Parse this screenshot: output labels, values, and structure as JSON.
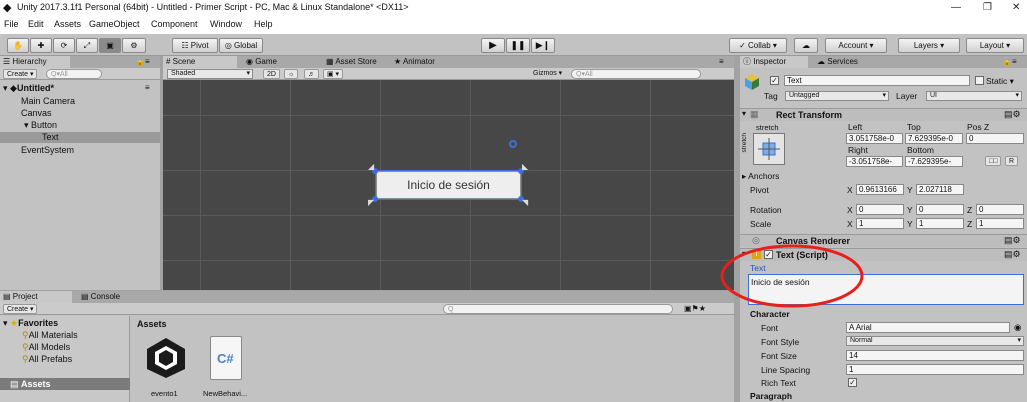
{
  "window": {
    "title": "Unity 2017.3.1f1 Personal (64bit) - Untitled - Primer Script - PC, Mac & Linux Standalone* <DX11>",
    "min_glyph": "—",
    "max_glyph": "❐",
    "close_glyph": "✕"
  },
  "menu": [
    "File",
    "Edit",
    "Assets",
    "GameObject",
    "Component",
    "Window",
    "Help"
  ],
  "toolbar": {
    "pivot": "Pivot",
    "global": "Global",
    "collab": "Collab ▾",
    "account": "Account",
    "layers": "Layers",
    "layout": "Layout"
  },
  "hierarchy": {
    "tab": "Hierarchy",
    "create": "Create ▾",
    "search_placeholder": "Q▾All",
    "scene": "Untitled*",
    "items": [
      "Main Camera",
      "Canvas",
      "Button",
      "Text",
      "EventSystem"
    ]
  },
  "scene_view": {
    "tabs": [
      "Scene",
      "Game",
      "Asset Store",
      "Animator"
    ],
    "shaded": "Shaded",
    "mode2d": "2D",
    "gizmos": "Gizmos ▾",
    "search_placeholder": "Q▾All",
    "button_text": "Inicio de sesión"
  },
  "project": {
    "tabs": [
      "Project",
      "Console"
    ],
    "create": "Create ▾",
    "favorites": "Favorites",
    "fav_items": [
      "All Materials",
      "All Models",
      "All Prefabs"
    ],
    "assets_folder": "Assets",
    "assets_header": "Assets",
    "files": [
      "evento1",
      "NewBehavi..."
    ]
  },
  "inspector": {
    "tabs": [
      "Inspector",
      "Services"
    ],
    "object_name": "Text",
    "static_label": "Static ▾",
    "tag_label": "Tag",
    "tag_value": "Untagged",
    "layer_label": "Layer",
    "layer_value": "UI",
    "rect_transform": {
      "title": "Rect Transform",
      "stretch": "stretch",
      "stretch_side": "stretch",
      "left_label": "Left",
      "top_label": "Top",
      "posz_label": "Pos Z",
      "left": "3.051758e-0",
      "top": "7.629395e-0",
      "posz": "0",
      "right_label": "Right",
      "bottom_label": "Bottom",
      "right": "-3.051758e-",
      "bottom": "-7.629395e-",
      "r_button": "R",
      "anchors": "Anchors",
      "pivot_label": "Pivot",
      "pivot_x": "0.9613166",
      "pivot_y": "2.027118",
      "rotation_label": "Rotation",
      "rot_x": "0",
      "rot_y": "0",
      "rot_z": "0",
      "scale_label": "Scale",
      "scale_x": "1",
      "scale_y": "1",
      "scale_z": "1",
      "x": "X",
      "y": "Y",
      "z": "Z"
    },
    "canvas_renderer": "Canvas Renderer",
    "text_script": {
      "title": "Text (Script)",
      "text_label": "Text",
      "text_value": "Inicio de sesión",
      "character_label": "Character",
      "font_label": "Font",
      "font_value": "Arial",
      "font_style_label": "Font Style",
      "font_style_value": "Normal",
      "font_size_label": "Font Size",
      "font_size_value": "14",
      "line_spacing_label": "Line Spacing",
      "line_spacing_value": "1",
      "rich_text_label": "Rich Text",
      "paragraph_label": "Paragraph"
    }
  },
  "colors": {
    "annotation_circle": "#e8201c",
    "selection": "#3d6fd6",
    "scene_bg": "#474747"
  }
}
